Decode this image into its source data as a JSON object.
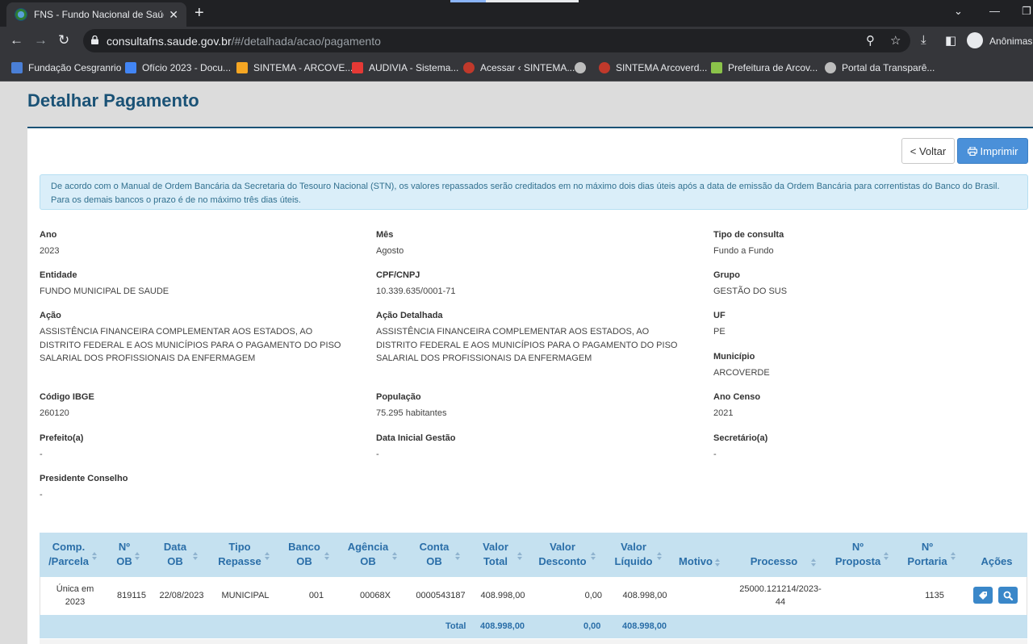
{
  "browser": {
    "tab_title": "FNS - Fundo Nacional de Saúde",
    "url_host": "consultafns.saude.gov.br",
    "url_path": "/#/detalhada/acao/pagamento",
    "profile_label": "Anônimas (",
    "bookmarks": [
      {
        "label": "Fundação Cesgranrio",
        "icon": "cesgranrio-icon",
        "color": "#4a7fd6"
      },
      {
        "label": "Ofício 2023 - Docu...",
        "icon": "docs-icon",
        "color": "#4285f4"
      },
      {
        "label": "SINTEMA - ARCOVE...",
        "icon": "sintema-icon",
        "color": "#f5a623"
      },
      {
        "label": "AUDIVIA - Sistema...",
        "icon": "audivia-icon",
        "color": "#e53935"
      },
      {
        "label": "Acessar ‹ SINTEMA...",
        "icon": "sintema-red-icon",
        "color": "#c0392b"
      },
      {
        "label": "",
        "icon": "globe-icon",
        "color": "#bdbdbd"
      },
      {
        "label": "SINTEMA Arcoverd...",
        "icon": "sintema-red-icon",
        "color": "#c0392b"
      },
      {
        "label": "Prefeitura de Arcov...",
        "icon": "prefeitura-icon",
        "color": "#8bc34a"
      },
      {
        "label": "Portal da Transparê...",
        "icon": "globe-icon",
        "color": "#bdbdbd"
      }
    ]
  },
  "page": {
    "title": "Detalhar Pagamento",
    "voltar_label": "< Voltar",
    "imprimir_label": "Imprimir",
    "alert_line1": "De acordo com o Manual de Ordem Bancária da Secretaria do Tesouro Nacional (STN), os valores repassados serão creditados em no máximo dois dias úteis após a data de emissão da Ordem Bancária para correntistas do Banco do Brasil.",
    "alert_line2": "Para os demais bancos o prazo é de no máximo três dias úteis."
  },
  "fields": {
    "ano": {
      "label": "Ano",
      "value": "2023"
    },
    "mes": {
      "label": "Mês",
      "value": "Agosto"
    },
    "tipo_consulta": {
      "label": "Tipo de consulta",
      "value": "Fundo a Fundo"
    },
    "entidade": {
      "label": "Entidade",
      "value": "FUNDO MUNICIPAL DE SAUDE"
    },
    "cpf_cnpj": {
      "label": "CPF/CNPJ",
      "value": "10.339.635/0001-71"
    },
    "grupo": {
      "label": "Grupo",
      "value": "GESTÃO DO SUS"
    },
    "acao": {
      "label": "Ação",
      "value": "ASSISTÊNCIA FINANCEIRA COMPLEMENTAR AOS ESTADOS, AO DISTRITO FEDERAL E AOS MUNICÍPIOS PARA O PAGAMENTO DO PISO SALARIAL DOS PROFISSIONAIS DA ENFERMAGEM"
    },
    "acao_detalhada": {
      "label": "Ação Detalhada",
      "value": "ASSISTÊNCIA FINANCEIRA COMPLEMENTAR AOS ESTADOS, AO DISTRITO FEDERAL E AOS MUNICÍPIOS PARA O PAGAMENTO DO PISO SALARIAL DOS PROFISSIONAIS DA ENFERMAGEM"
    },
    "uf": {
      "label": "UF",
      "value": "PE"
    },
    "municipio": {
      "label": "Município",
      "value": "ARCOVERDE"
    },
    "codigo_ibge": {
      "label": "Código IBGE",
      "value": "260120"
    },
    "populacao": {
      "label": "População",
      "value": "75.295 habitantes"
    },
    "ano_censo": {
      "label": "Ano Censo",
      "value": "2021"
    },
    "prefeito": {
      "label": "Prefeito(a)",
      "value": "-"
    },
    "data_inicial_gestao": {
      "label": "Data Inicial Gestão",
      "value": "-"
    },
    "secretario": {
      "label": "Secretário(a)",
      "value": "-"
    },
    "presidente_conselho": {
      "label": "Presidente Conselho",
      "value": "-"
    }
  },
  "table": {
    "headers": {
      "comp_parcela": [
        "Comp.",
        "/Parcela"
      ],
      "n_ob": [
        "Nº",
        "OB"
      ],
      "data_ob": [
        "Data",
        "OB"
      ],
      "tipo_repasse": [
        "Tipo",
        "Repasse"
      ],
      "banco_ob": [
        "Banco",
        "OB"
      ],
      "agencia_ob": [
        "Agência",
        "OB"
      ],
      "conta_ob": [
        "Conta",
        "OB"
      ],
      "valor_total": [
        "Valor",
        "Total"
      ],
      "valor_desconto": [
        "Valor",
        "Desconto"
      ],
      "valor_liquido": [
        "Valor",
        "Líquido"
      ],
      "motivo": "Motivo",
      "processo": "Processo",
      "n_proposta": [
        "Nº",
        "Proposta"
      ],
      "n_portaria": [
        "Nº",
        "Portaria"
      ],
      "acoes": "Ações"
    },
    "rows": [
      {
        "comp_parcela": [
          "Única em",
          "2023"
        ],
        "n_ob": "819115",
        "data_ob": "22/08/2023",
        "tipo_repasse": "MUNICIPAL",
        "banco_ob": "001",
        "agencia_ob": "00068X",
        "conta_ob": "0000543187",
        "valor_total": "408.998,00",
        "valor_desconto": "0,00",
        "valor_liquido": "408.998,00",
        "motivo": "",
        "processo": [
          "25000.121214/2023-",
          "44"
        ],
        "n_proposta": "",
        "n_portaria": "1135"
      }
    ],
    "total": {
      "label": "Total",
      "valor_total": "408.998,00",
      "valor_desconto": "0,00",
      "valor_liquido": "408.998,00"
    }
  }
}
